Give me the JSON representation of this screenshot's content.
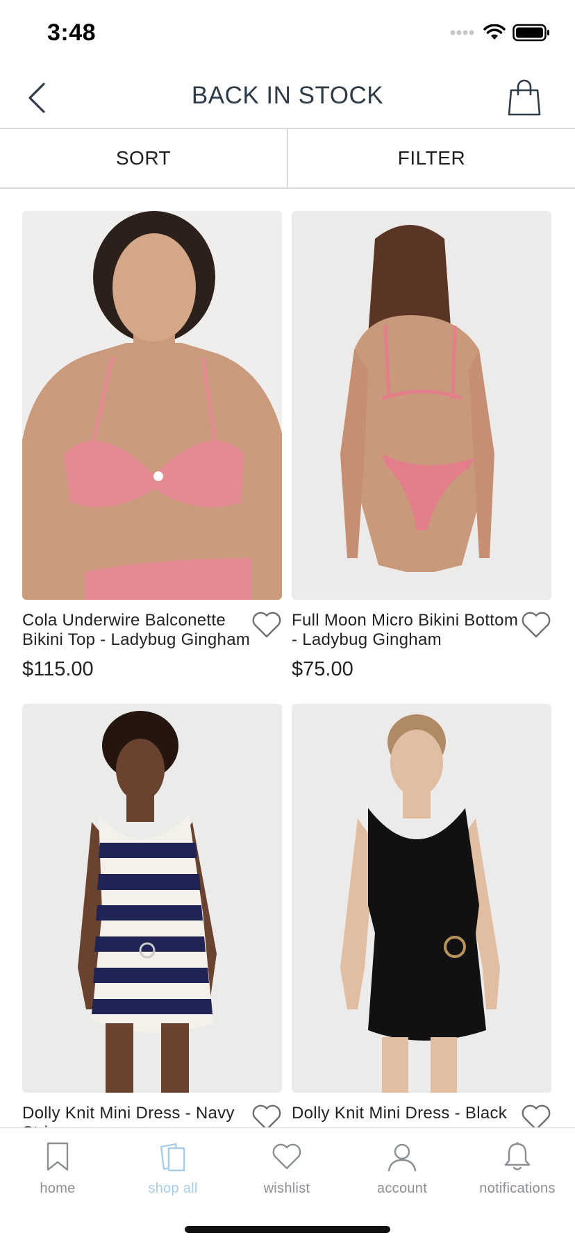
{
  "status_bar": {
    "time": "3:48"
  },
  "header": {
    "title": "BACK IN STOCK",
    "back_icon": "chevron-left-icon",
    "bag_icon": "shopping-bag-icon"
  },
  "toolbar": {
    "sort_label": "SORT",
    "filter_label": "FILTER"
  },
  "products": [
    {
      "name": "Cola Underwire Balconette Bikini Top - Ladybug Gingham",
      "price": "$115.00"
    },
    {
      "name": "Full Moon Micro Bikini Bottom - Ladybug Gingham",
      "price": "$75.00"
    },
    {
      "name": "Dolly Knit Mini Dress - Navy Stripe",
      "price": ""
    },
    {
      "name": "Dolly Knit Mini Dress - Black",
      "price": ""
    }
  ],
  "tabs": [
    {
      "label": "home",
      "icon": "bookmark-icon",
      "active": false
    },
    {
      "label": "shop all",
      "icon": "shopping-bags-icon",
      "active": true
    },
    {
      "label": "wishlist",
      "icon": "heart-icon",
      "active": false
    },
    {
      "label": "account",
      "icon": "person-icon",
      "active": false
    },
    {
      "label": "notifications",
      "icon": "bell-icon",
      "active": false
    }
  ],
  "colors": {
    "accent_active_tab": "#a9cde6",
    "title_text": "#2f3b46",
    "divider": "#d9d9d9"
  }
}
